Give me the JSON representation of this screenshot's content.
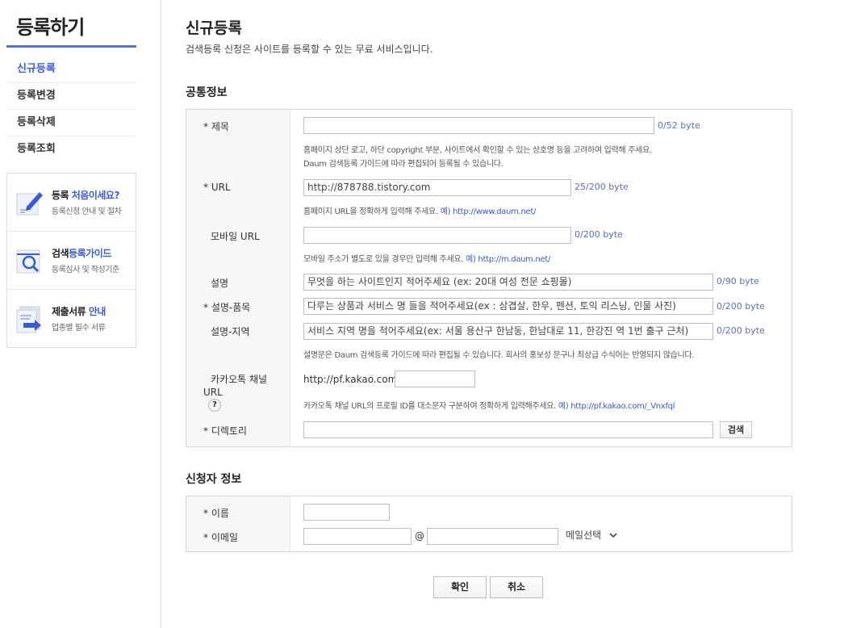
{
  "sidebar": {
    "title": "등록하기",
    "menu": [
      "신규등록",
      "등록변경",
      "등록삭제",
      "등록조회"
    ],
    "cards": [
      {
        "title_a": "등록 ",
        "title_b": "처음이세요?",
        "sub": "등록신청 안내 및 절차",
        "icon": "pencil-doc-icon"
      },
      {
        "title_a": "검색",
        "title_b": "등록가이드",
        "sub": "등록심사 및 작성기준",
        "icon": "magnifier-doc-icon"
      },
      {
        "title_a": "제출서류 ",
        "title_b": "안내",
        "sub": "업종별 필수 서류",
        "icon": "document-arrow-icon"
      }
    ]
  },
  "main": {
    "title": "신규등록",
    "desc": "검색등록 신청은 사이트를 등록할 수 있는 무료 서비스입니다.",
    "common_title": "공통정보",
    "applicant_title": "신청자 정보"
  },
  "form": {
    "title_label": "* 제목",
    "title_value": "",
    "title_count": "0/52 byte",
    "title_hint1": "홈페이지 상단 로고, 하단 copyright 부분, 사이트에서 확인할 수 있는 상호명 등을 고려하여 입력해 주세요.",
    "title_hint2": "Daum 검색등록 가이드에 따라 편집되어 등록될 수 있습니다.",
    "url_label": "* URL",
    "url_value": "http://878788.tistory.com",
    "url_count": "25/200 byte",
    "url_hint": "홈페이지 URL을 정확하게 입력해 주세요. ",
    "url_example": "예) http://www.daum.net/",
    "mobile_label": "모바일 URL",
    "mobile_value": "",
    "mobile_count": "0/200 byte",
    "mobile_hint": "모바일 주소가 별도로 있을 경우만 입력해 주세요. ",
    "mobile_example": "예) http://m.daum.net/",
    "desc_label": "설명",
    "desc_placeholder": "무엇을 하는 사이트인지 적어주세요 (ex: 20대 여성 전문 쇼핑몰)",
    "desc_count": "0/90 byte",
    "product_label": "* 설명-품목",
    "product_placeholder": "다루는 상품과 서비스 명 들을 적어주세요(ex : 삼겹살, 한우, 펜션, 토익 리스닝, 인물 사진)",
    "product_count": "0/200 byte",
    "region_label": "설명-지역",
    "region_placeholder": "서비스 지역 명을 적어주세요(ex: 서울  용산구 한남동, 한남대로 11, 한강진 역 1번 출구 근처)",
    "region_count": "0/200 byte",
    "desc_hint": "설명문은 Daum 검색등록 가이드에 따라 편집될 수 있습니다. 회사의 홍보성 문구나 최상급 수식어는 반영되지 않습니다.",
    "kakao_label1": "카카오톡 채널",
    "kakao_label2": "URL",
    "kakao_help": "?",
    "kakao_prefix": "http://pf.kakao.com/",
    "kakao_value": "",
    "kakao_hint": "카카오톡 채널 URL의 프로필 ID를 대소문자 구분하여 정확하게 입력해주세요. ",
    "kakao_example": "예) http://pf.kakao.com/_Vnxfql",
    "dir_label": "* 디렉토리",
    "dir_value": "",
    "dir_button": "검색",
    "name_label": "* 이름",
    "name_value": "",
    "email_label": "* 이메일",
    "email_at": "@",
    "email_select": "메일선택"
  },
  "buttons": {
    "confirm": "확인",
    "cancel": "취소"
  },
  "colors": {
    "accent": "#3b5bd6",
    "count": "#5a6fb8"
  }
}
